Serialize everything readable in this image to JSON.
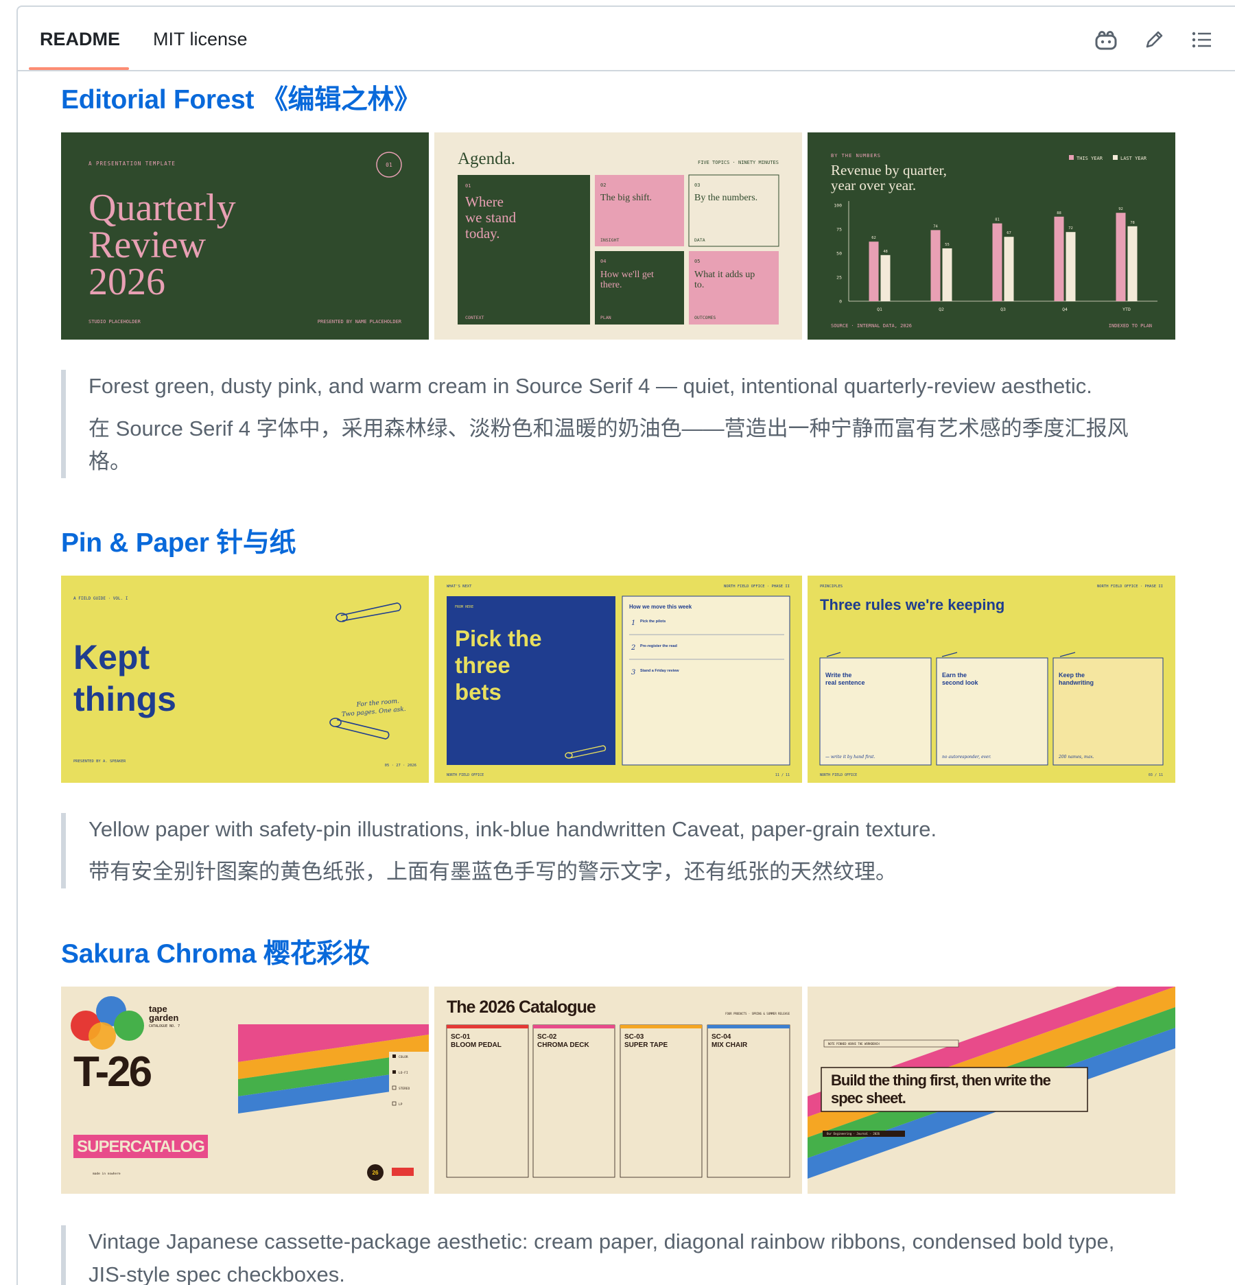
{
  "tabs": {
    "readme": "README",
    "license": "MIT license"
  },
  "sections": [
    {
      "title": "Editorial Forest 《编辑之林》",
      "desc_en": "Forest green, dusty pink, and warm cream in Source Serif 4 — quiet, intentional quarterly-review aesthetic.",
      "desc_zh_1": "在 Source Serif 4 字体中，采用森林绿、淡粉色和温暖的奶油色——营造出一种宁静而富有艺术感的季度汇报风",
      "desc_zh_2": "格。",
      "slides": {
        "s1": {
          "kicker": "A PRESENTATION TEMPLATE",
          "badge": "01",
          "line1": "Quarterly",
          "line2": "Review",
          "line3": "2026",
          "left_foot": "STUDIO PLACEHOLDER",
          "right_foot": "PRESENTED BY NAME PLACEHOLDER"
        },
        "s2": {
          "title": "Agenda.",
          "top_right": "FIVE TOPICS · NINETY MINUTES",
          "c1_num": "01",
          "c1_l1": "Where",
          "c1_l2": "we stand",
          "c1_l3": "today.",
          "c1_tag": "CONTEXT",
          "c2_num": "02",
          "c2_text": "The big shift.",
          "c2_tag": "INSIGHT",
          "c3_num": "03",
          "c3_text": "By the numbers.",
          "c3_tag": "DATA",
          "c4_num": "04",
          "c4_l1": "How we'll get",
          "c4_l2": "there.",
          "c4_tag": "PLAN",
          "c5_num": "05",
          "c5_l1": "What it adds up",
          "c5_l2": "to.",
          "c5_tag": "OUTCOMES"
        },
        "s3": {
          "kicker": "BY THE NUMBERS",
          "title1": "Revenue by quarter,",
          "title2": "year over year.",
          "legend_this": "THIS YEAR",
          "legend_last": "LAST YEAR",
          "source": "SOURCE · INTERNAL DATA, 2026",
          "indexed": "INDEXED TO PLAN"
        }
      }
    },
    {
      "title": "Pin & Paper 针与纸",
      "desc_en": "Yellow paper with safety-pin illustrations, ink-blue handwritten Caveat, paper-grain texture.",
      "desc_zh_1": "带有安全别针图案的黄色纸张，上面有墨蓝色手写的警示文字，还有纸张的天然纹理。",
      "slides": {
        "s1": {
          "kicker": "A FIELD GUIDE · VOL. I",
          "line1": "Kept",
          "line2": "things",
          "note1": "For the room.",
          "note2": "Two pages. One ask.",
          "foot_left": "PRESENTED BY A. SPEAKER",
          "foot_right": "05 · 27 · 2026"
        },
        "s2": {
          "kicker": "WHAT'S NEXT",
          "top_right": "NORTH FIELD OFFICE · PHASE II",
          "label": "FROM HERE",
          "l1": "Pick the",
          "l2": "three",
          "l3": "bets",
          "card_title": "How we move this week",
          "n1": "1",
          "n2": "2",
          "n3": "3",
          "i1": "Pick the pilots",
          "i2": "Pre-register the read",
          "i3": "Stand a Friday review",
          "foot_left": "NORTH FIELD OFFICE",
          "foot_right": "11 / 11"
        },
        "s3": {
          "kicker": "PRINCIPLES",
          "top_right": "NORTH FIELD OFFICE · PHASE II",
          "title": "Three rules we're keeping",
          "n1a": "Write the",
          "n1b": "real sentence",
          "n1s": "— write it by hand first.",
          "n2a": "Earn the",
          "n2b": "second look",
          "n2s": "no autoresponder, ever.",
          "n3a": "Keep the",
          "n3b": "handwriting",
          "n3s": "200 names, max.",
          "foot_left": "NORTH FIELD OFFICE",
          "foot_right": "03 / 11"
        }
      }
    },
    {
      "title": "Sakura Chroma 樱花彩妆",
      "desc_en": "Vintage Japanese cassette-package aesthetic: cream paper, diagonal rainbow ribbons, condensed bold type,",
      "desc_en_2": "JIS-style spec checkboxes.",
      "slides": {
        "s1": {
          "brand1": "tape",
          "brand2": "garden",
          "brand3": "CATALOGUE NO. 7",
          "model": "T-26",
          "banner": "SUPERCATALOG",
          "cb1": "COLOR",
          "cb2": "LO-FI",
          "cb3": "STEREO",
          "cb4": "LP",
          "foot": "made in nowhere",
          "sticker": "26"
        },
        "s2": {
          "title": "The 2026 Catalogue",
          "sub": "FOUR PRODUCTS · SPRING & SUMMER RELEASE",
          "p1a": "SC-01",
          "p1b": "BLOOM PEDAL",
          "p2a": "SC-02",
          "p2b": "CHROMA DECK",
          "p3a": "SC-03",
          "p3b": "SUPER TAPE",
          "p4a": "SC-04",
          "p4b": "MIX CHAIR"
        },
        "s3": {
          "kicker": "NOTE PINNED ABOVE THE WORKBENCH",
          "q1": "Build the thing first, then write the",
          "q2": "spec sheet.",
          "attrib": "Our Engineering · Journal · 2026"
        }
      }
    }
  ],
  "chart_data": {
    "type": "bar",
    "categories": [
      "Q1",
      "Q2",
      "Q3",
      "Q4",
      "YTD"
    ],
    "series": [
      {
        "name": "THIS YEAR",
        "values": [
          62,
          74,
          81,
          88,
          92
        ],
        "color": "#e8a0b4"
      },
      {
        "name": "LAST YEAR",
        "values": [
          48,
          55,
          67,
          72,
          78
        ],
        "color": "#f3ead8"
      }
    ],
    "yticks": [
      0,
      25,
      50,
      75,
      100
    ],
    "ylim": [
      0,
      100
    ],
    "grid": false
  },
  "colors": {
    "link": "#0969da",
    "forest": "#2f4a2c",
    "pink": "#e8a0b4",
    "cream": "#f1e9d6",
    "yellow": "#e8df5e",
    "ink": "#1f3d8f"
  }
}
